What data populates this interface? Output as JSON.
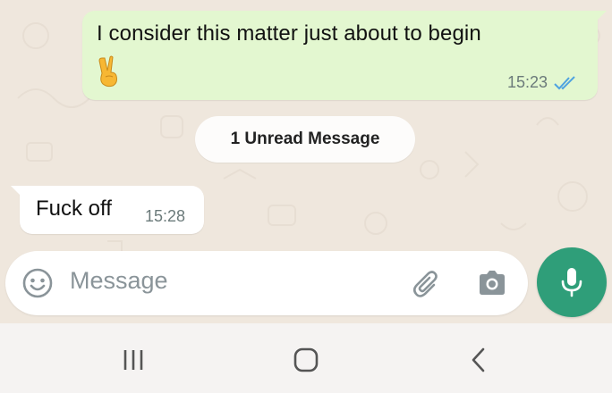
{
  "conversation": {
    "outgoing_message": {
      "text": "I consider this matter just about to begin",
      "emoji": "victory-hand-emoji",
      "time": "15:23",
      "status": "read",
      "status_icon": "double-check-icon"
    },
    "unread_divider": "1 Unread Message",
    "incoming_message": {
      "text": "Fuck off",
      "time": "15:28"
    }
  },
  "composer": {
    "placeholder": "Message",
    "emoji_icon": "smiley-icon",
    "attach_icon": "paperclip-icon",
    "camera_icon": "camera-icon",
    "mic_icon": "microphone-icon"
  },
  "system_nav": {
    "recents_icon": "recents-icon",
    "home_icon": "home-icon",
    "back_icon": "back-icon"
  },
  "colors": {
    "chat_background": "#efe7dd",
    "outgoing_bubble": "#e3f7d0",
    "incoming_bubble": "#ffffff",
    "read_ticks": "#4fa3e0",
    "accent": "#2f9e79"
  }
}
